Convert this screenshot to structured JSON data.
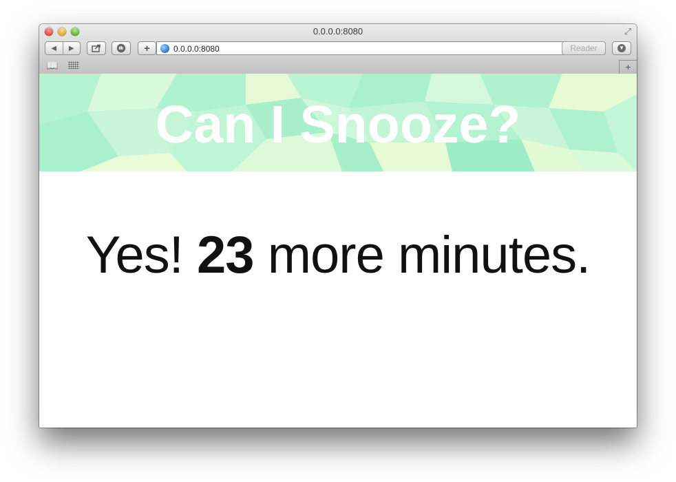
{
  "browser": {
    "window_title": "0.0.0.0:8080",
    "address": "0.0.0.0:8080",
    "reader_label": "Reader",
    "new_tab_label": "+",
    "add_bookmark_label": "+",
    "icons": {
      "back": "chevron-left-icon",
      "forward": "chevron-right-icon",
      "share": "share-icon",
      "pin": "hand-icon",
      "globe": "globe-icon",
      "reload": "reload-icon",
      "download": "download-icon",
      "bookmarks": "book-icon",
      "top_sites": "grid-icon",
      "fullscreen": "fullscreen-icon"
    }
  },
  "page": {
    "header_title": "Can I Snooze?",
    "answer_prefix": "Yes!",
    "minutes": "23",
    "answer_suffix": "more minutes."
  },
  "colors": {
    "hero_mint": "#aef5cd",
    "hero_light": "#e9fbd9",
    "hero_text": "#ffffff"
  }
}
